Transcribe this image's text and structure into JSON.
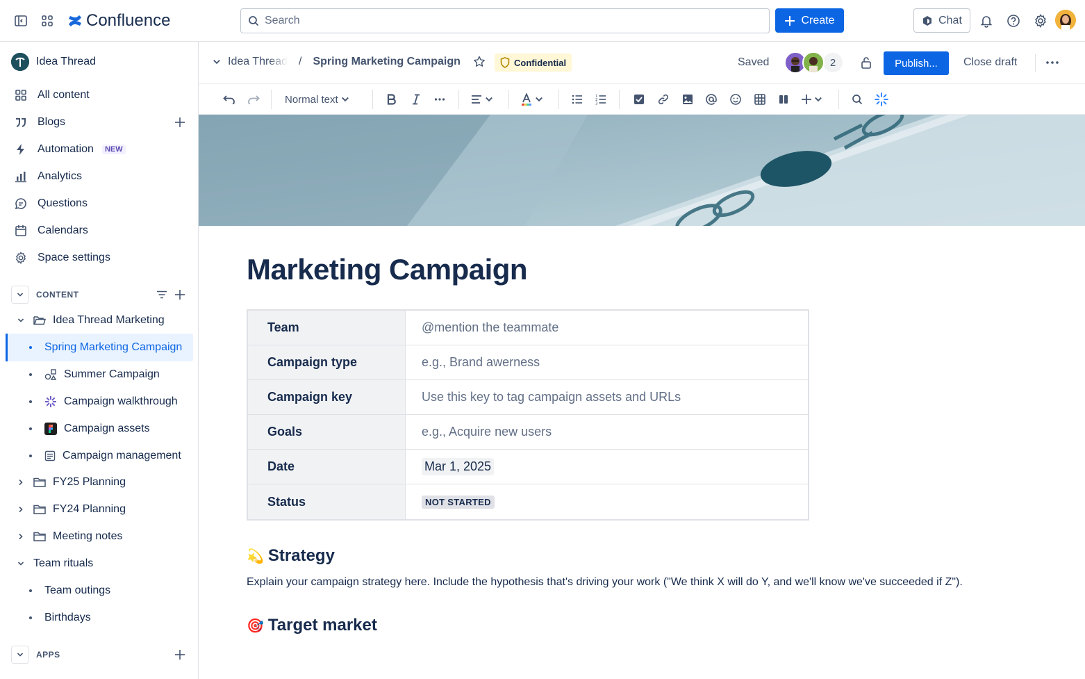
{
  "app": {
    "name": "Confluence"
  },
  "topbar": {
    "search_placeholder": "Search",
    "create_label": "Create",
    "chat_label": "Chat"
  },
  "sidebar": {
    "space_name": "Idea Thread",
    "nav": [
      {
        "label": "All content",
        "icon": "grid-icon"
      },
      {
        "label": "Blogs",
        "icon": "quote-icon"
      },
      {
        "label": "Automation",
        "icon": "lightning-icon",
        "badge": "NEW"
      },
      {
        "label": "Analytics",
        "icon": "bar-chart-icon"
      },
      {
        "label": "Questions",
        "icon": "speech-bubble-icon"
      },
      {
        "label": "Calendars",
        "icon": "calendar-icon"
      },
      {
        "label": "Space settings",
        "icon": "gear-icon"
      }
    ],
    "content_section": "CONTENT",
    "tree": [
      {
        "label": "Idea Thread Marketing",
        "icon": "folder-open-icon"
      },
      {
        "label": "Spring Marketing Campaign"
      },
      {
        "label": "Summer Campaign",
        "icon": "shapes-icon"
      },
      {
        "label": "Campaign walkthrough",
        "icon": "sparkle-icon"
      },
      {
        "label": "Campaign assets",
        "icon": "figma-icon"
      },
      {
        "label": "Campaign management",
        "icon": "document-icon"
      },
      {
        "label": "FY25 Planning",
        "icon": "folder-icon"
      },
      {
        "label": "FY24 Planning",
        "icon": "folder-icon"
      },
      {
        "label": "Meeting notes",
        "icon": "folder-icon"
      },
      {
        "label": "Team rituals"
      },
      {
        "label": "Team outings"
      },
      {
        "label": "Birthdays"
      }
    ],
    "apps_section": "APPS"
  },
  "pageheader": {
    "breadcrumb_parent": "Idea Thread",
    "breadcrumb_current": "Spring Marketing Campaign",
    "classification": "Confidential",
    "save_status": "Saved",
    "collaborator_count": "2",
    "publish_label": "Publish...",
    "close_draft_label": "Close draft"
  },
  "toolbar": {
    "text_style": "Normal text"
  },
  "page": {
    "title": "Marketing Campaign",
    "table": [
      {
        "key": "Team",
        "value": "@mention the teammate"
      },
      {
        "key": "Campaign type",
        "value": "e.g., Brand awerness"
      },
      {
        "key": "Campaign key",
        "value": "Use this key to tag campaign assets and URLs"
      },
      {
        "key": "Goals",
        "value": "e.g., Acquire new users"
      },
      {
        "key": "Date",
        "value": "Mar 1, 2025"
      },
      {
        "key": "Status",
        "value": "NOT STARTED"
      }
    ],
    "strategy_heading": "Strategy",
    "strategy_emoji": "💫",
    "strategy_text": "Explain your campaign strategy here. Include the hypothesis that's driving your work (\"We think X will do Y, and we'll know we've succeeded if Z\").",
    "target_heading": "Target market",
    "target_emoji": "🎯"
  },
  "colors": {
    "brand_blue": "#0c66e4",
    "selected_bg": "#e9f2ff",
    "confidential_bg": "#fff7d6"
  }
}
